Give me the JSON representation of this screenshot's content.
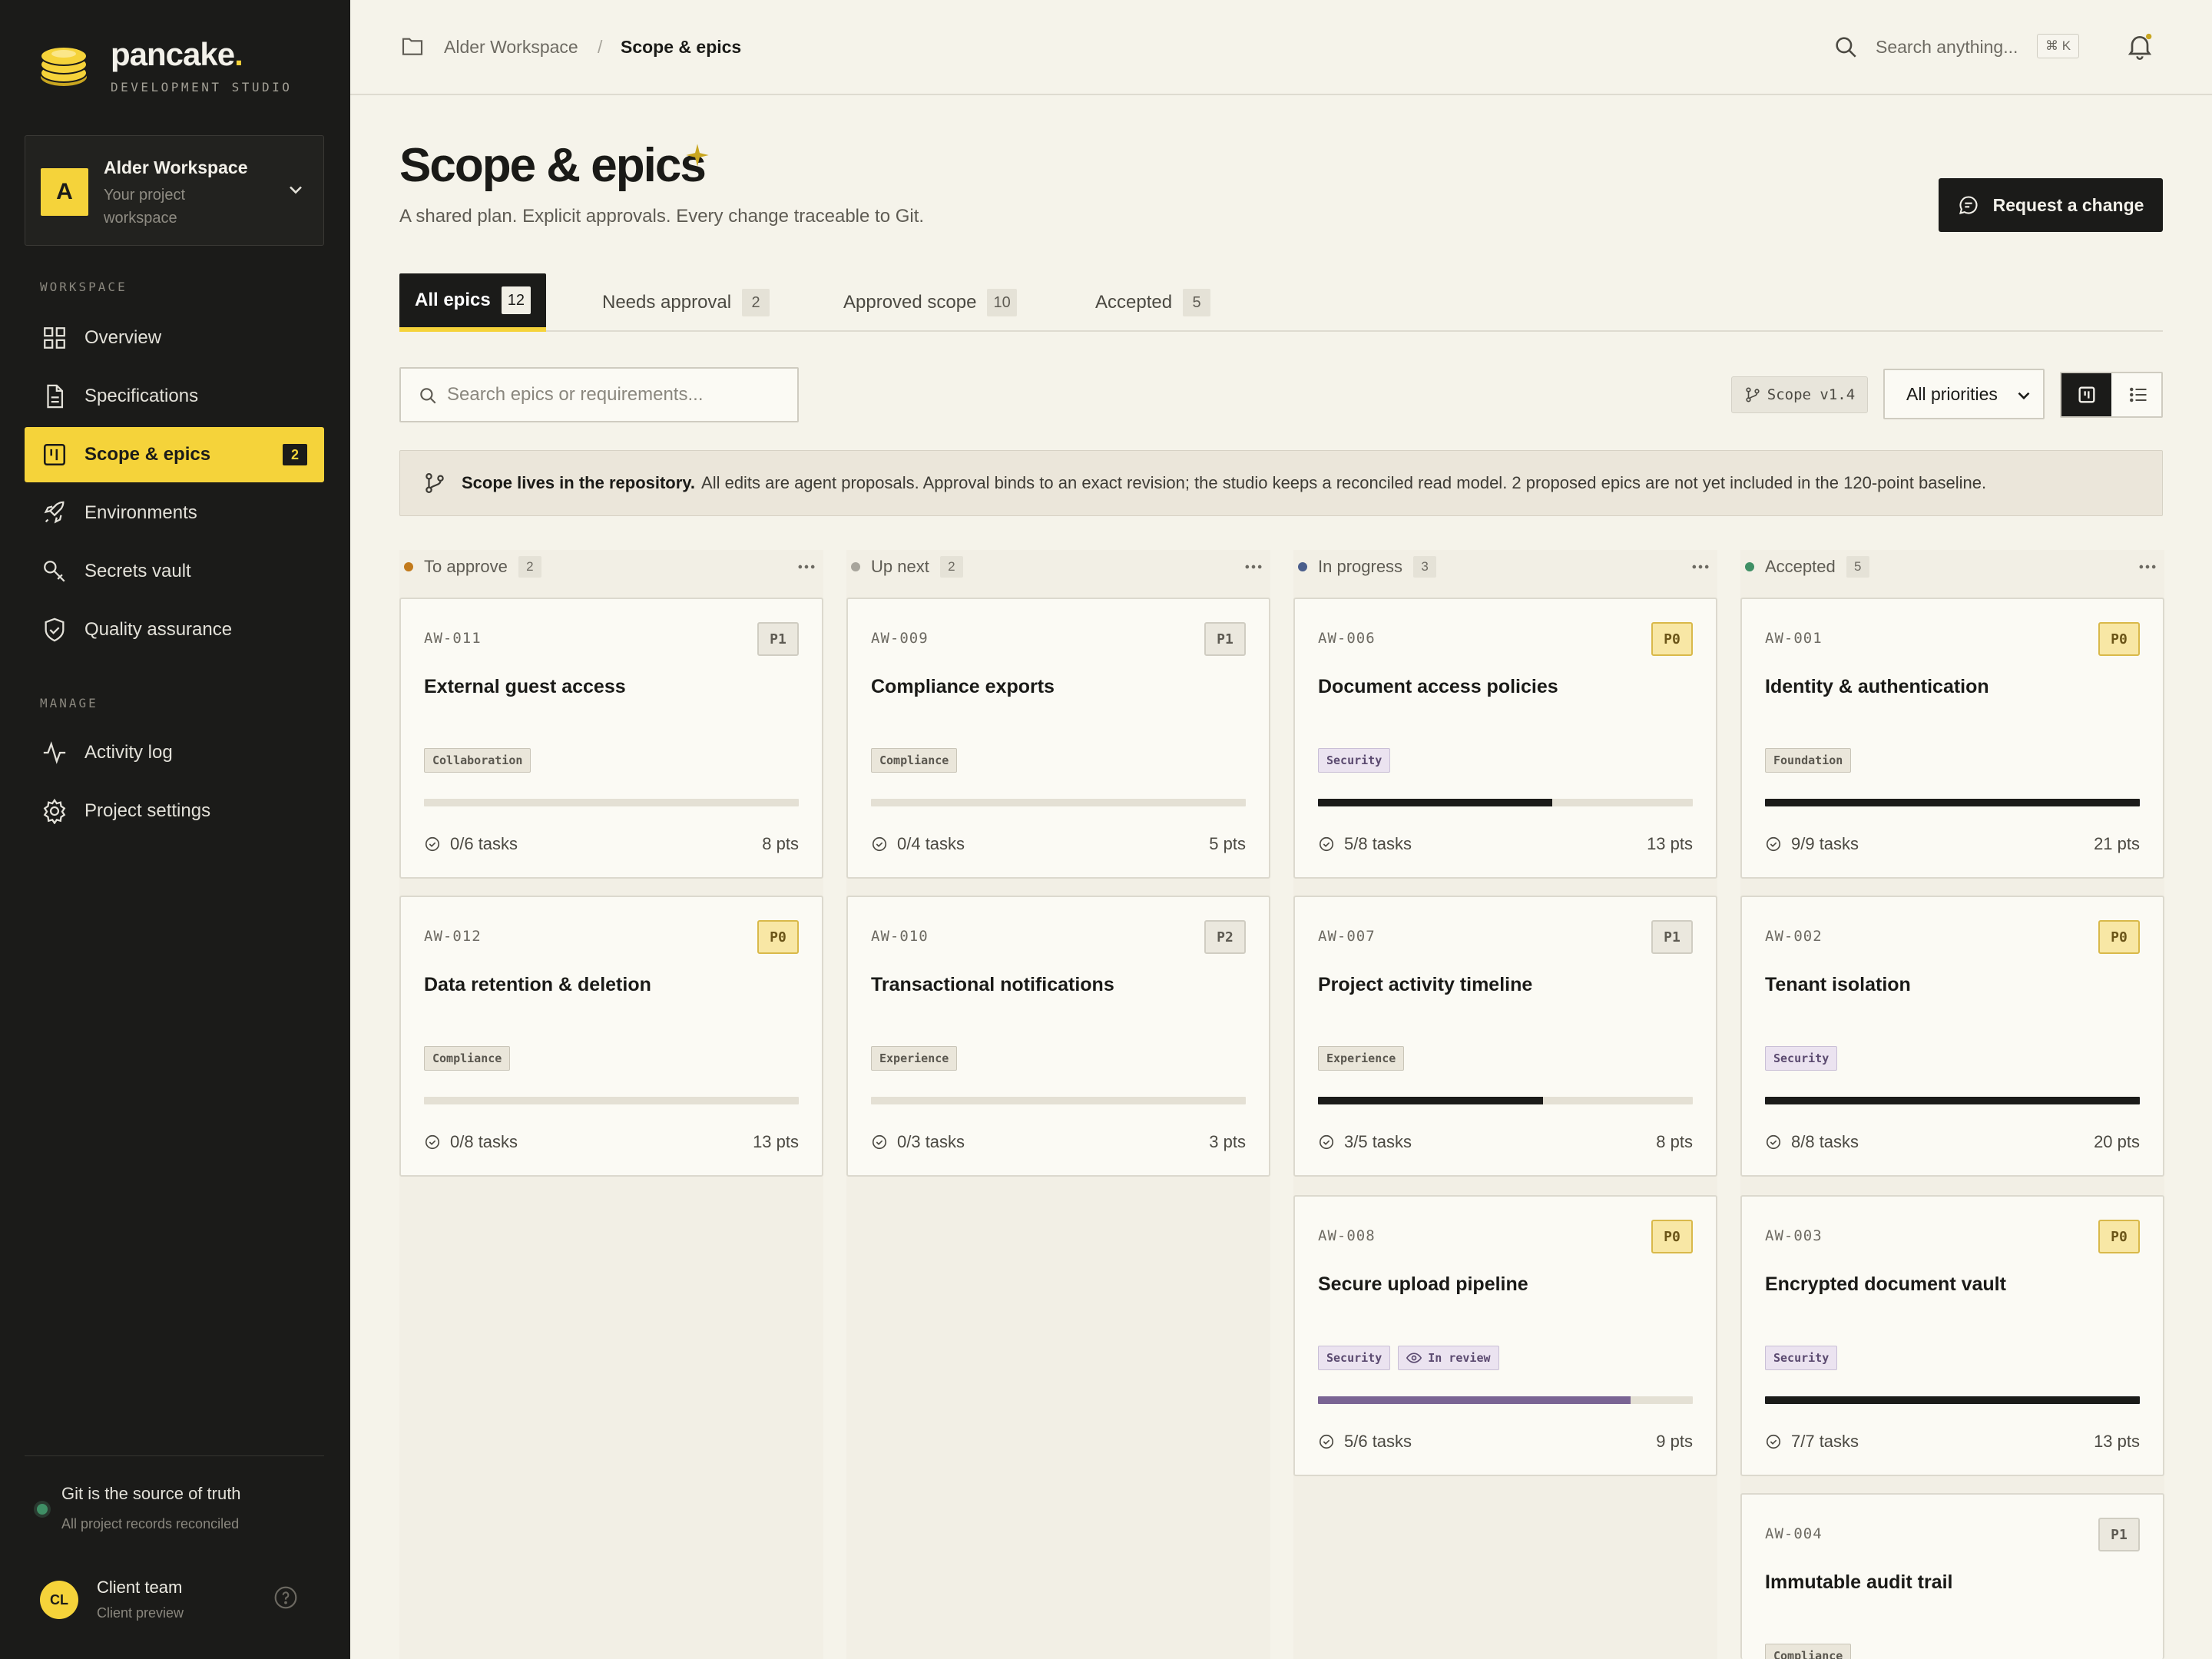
{
  "brand": {
    "name": "pancake",
    "dot": ".",
    "subtitle": "DEVELOPMENT STUDIO"
  },
  "workspace": {
    "initial": "A",
    "name": "Alder Workspace",
    "description": "Your project workspace"
  },
  "sidebar": {
    "workspace_heading": "WORKSPACE",
    "manage_heading": "MANAGE",
    "items": [
      {
        "label": "Overview",
        "icon": "grid-icon"
      },
      {
        "label": "Specifications",
        "icon": "document-icon"
      },
      {
        "label": "Scope & epics",
        "icon": "board-icon",
        "badge": "2",
        "active": true
      },
      {
        "label": "Environments",
        "icon": "rocket-icon"
      },
      {
        "label": "Secrets vault",
        "icon": "key-icon"
      },
      {
        "label": "Quality assurance",
        "icon": "shield-icon"
      }
    ],
    "manage_items": [
      {
        "label": "Activity log",
        "icon": "activity-icon"
      },
      {
        "label": "Project settings",
        "icon": "gear-icon"
      }
    ],
    "git": {
      "title": "Git is the source of truth",
      "subtitle": "All project records reconciled"
    },
    "user": {
      "initials": "CL",
      "name": "Client team",
      "role": "Client preview"
    }
  },
  "topbar": {
    "breadcrumb": [
      "Alder Workspace",
      "Scope & epics"
    ],
    "separator": "/",
    "search_placeholder": "Search anything...",
    "shortcut": "⌘ K"
  },
  "header": {
    "title": "Scope & epics",
    "subtitle": "A shared plan. Explicit approvals. Every change traceable to Git.",
    "cta": "Request a change"
  },
  "tabs": [
    {
      "label": "All epics",
      "count": "12",
      "active": true
    },
    {
      "label": "Needs approval",
      "count": "2"
    },
    {
      "label": "Approved scope",
      "count": "10"
    },
    {
      "label": "Accepted",
      "count": "5"
    }
  ],
  "toolbar": {
    "search_placeholder": "Search epics or requirements...",
    "scope_version": "Scope v1.4",
    "priority_filter": "All priorities"
  },
  "notice": {
    "bold": "Scope lives in the repository.",
    "text": "All edits are agent proposals. Approval binds to an exact revision; the studio keeps a reconciled read model. 2 proposed epics are not yet included in the 120-point baseline."
  },
  "colors": {
    "accent": "#f5d33a",
    "dark": "#1b1b19",
    "to_approve": "#c27a1c",
    "up_next": "#a8a59c",
    "in_progress": "#4a5e8c",
    "accepted": "#3f8f65"
  },
  "columns": [
    {
      "title": "To approve",
      "count": "2",
      "dot": "#c27a1c",
      "cards": [
        {
          "id": "AW-011",
          "priority": "P1",
          "title": "External guest access",
          "tags": [
            "Collaboration"
          ],
          "tasks": "0/6 tasks",
          "progress": 0,
          "pts": "8 pts"
        },
        {
          "id": "AW-012",
          "priority": "P0",
          "title": "Data retention & deletion",
          "tags": [
            "Compliance"
          ],
          "tasks": "0/8 tasks",
          "progress": 0,
          "pts": "13 pts"
        }
      ]
    },
    {
      "title": "Up next",
      "count": "2",
      "dot": "#a8a59c",
      "cards": [
        {
          "id": "AW-009",
          "priority": "P1",
          "title": "Compliance exports",
          "tags": [
            "Compliance"
          ],
          "tasks": "0/4 tasks",
          "progress": 0,
          "pts": "5 pts"
        },
        {
          "id": "AW-010",
          "priority": "P2",
          "title": "Transactional notifications",
          "tags": [
            "Experience"
          ],
          "tasks": "0/3 tasks",
          "progress": 0,
          "pts": "3 pts"
        }
      ]
    },
    {
      "title": "In progress",
      "count": "3",
      "dot": "#4a5e8c",
      "cards": [
        {
          "id": "AW-006",
          "priority": "P0",
          "title": "Document access policies",
          "tags": [
            "Security"
          ],
          "tasks": "5/8 tasks",
          "progress": 0.625,
          "pts": "13 pts"
        },
        {
          "id": "AW-007",
          "priority": "P1",
          "title": "Project activity timeline",
          "tags": [
            "Experience"
          ],
          "tasks": "3/5 tasks",
          "progress": 0.6,
          "pts": "8 pts"
        },
        {
          "id": "AW-008",
          "priority": "P0",
          "title": "Secure upload pipeline",
          "tags": [
            "Security"
          ],
          "review": "In review",
          "tasks": "5/6 tasks",
          "progress": 0.833,
          "pts": "9 pts"
        }
      ]
    },
    {
      "title": "Accepted",
      "count": "5",
      "dot": "#3f8f65",
      "cards": [
        {
          "id": "AW-001",
          "priority": "P0",
          "title": "Identity & authentication",
          "tags": [
            "Foundation"
          ],
          "tasks": "9/9 tasks",
          "progress": 1,
          "pts": "21 pts"
        },
        {
          "id": "AW-002",
          "priority": "P0",
          "title": "Tenant isolation",
          "tags": [
            "Security"
          ],
          "tasks": "8/8 tasks",
          "progress": 1,
          "pts": "20 pts"
        },
        {
          "id": "AW-003",
          "priority": "P0",
          "title": "Encrypted document vault",
          "tags": [
            "Security"
          ],
          "tasks": "7/7 tasks",
          "progress": 1,
          "pts": "13 pts"
        },
        {
          "id": "AW-004",
          "priority": "P1",
          "title": "Immutable audit trail",
          "tags": [
            "Compliance"
          ],
          "tasks": "",
          "progress": 0,
          "pts": ""
        }
      ]
    }
  ]
}
